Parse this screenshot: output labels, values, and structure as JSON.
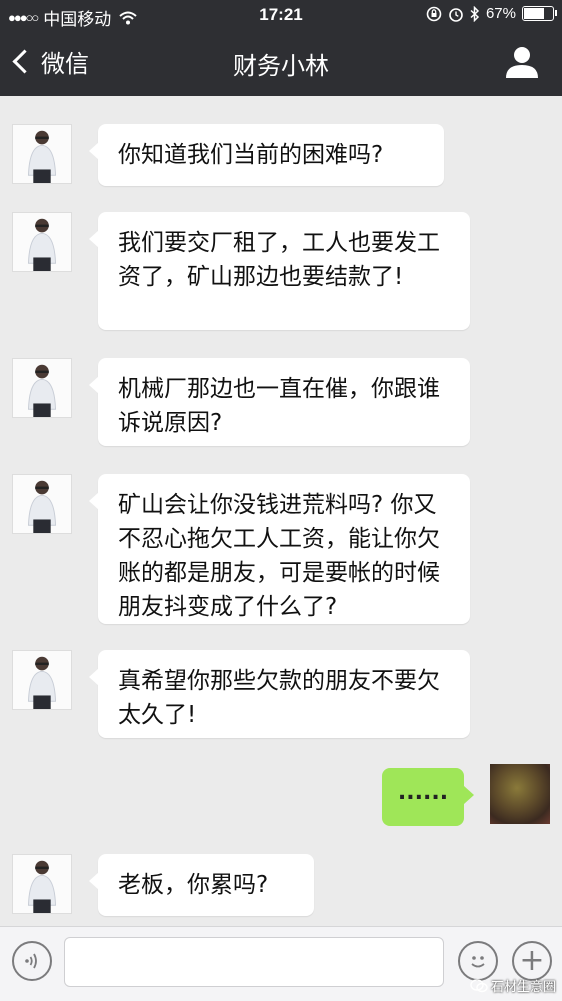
{
  "status_bar": {
    "signal": "●●●○○",
    "carrier": "中国移动",
    "time": "17:21",
    "battery_text": "67%",
    "battery_level": 0.67
  },
  "nav": {
    "back_label": "微信",
    "title": "财务小林"
  },
  "messages": [
    {
      "sender": "other",
      "text": "你知道我们当前的困难吗?"
    },
    {
      "sender": "other",
      "text": "我们要交厂租了，工人也要发工资了，矿山那边也要结款了!"
    },
    {
      "sender": "other",
      "text": "机械厂那边也一直在催，你跟谁诉说原因?"
    },
    {
      "sender": "other",
      "text": "矿山会让你没钱进荒料吗? 你又不忍心拖欠工人工资，能让你欠账的都是朋友，可是要帐的时候朋友抖变成了什么了?"
    },
    {
      "sender": "other",
      "text": "真希望你那些欠款的朋友不要欠太久了!"
    },
    {
      "sender": "me",
      "text": "......"
    },
    {
      "sender": "other",
      "text": "老板，你累吗?"
    }
  ],
  "input_bar": {
    "plus_symbol": "+"
  },
  "watermark": "石材生意圈"
}
